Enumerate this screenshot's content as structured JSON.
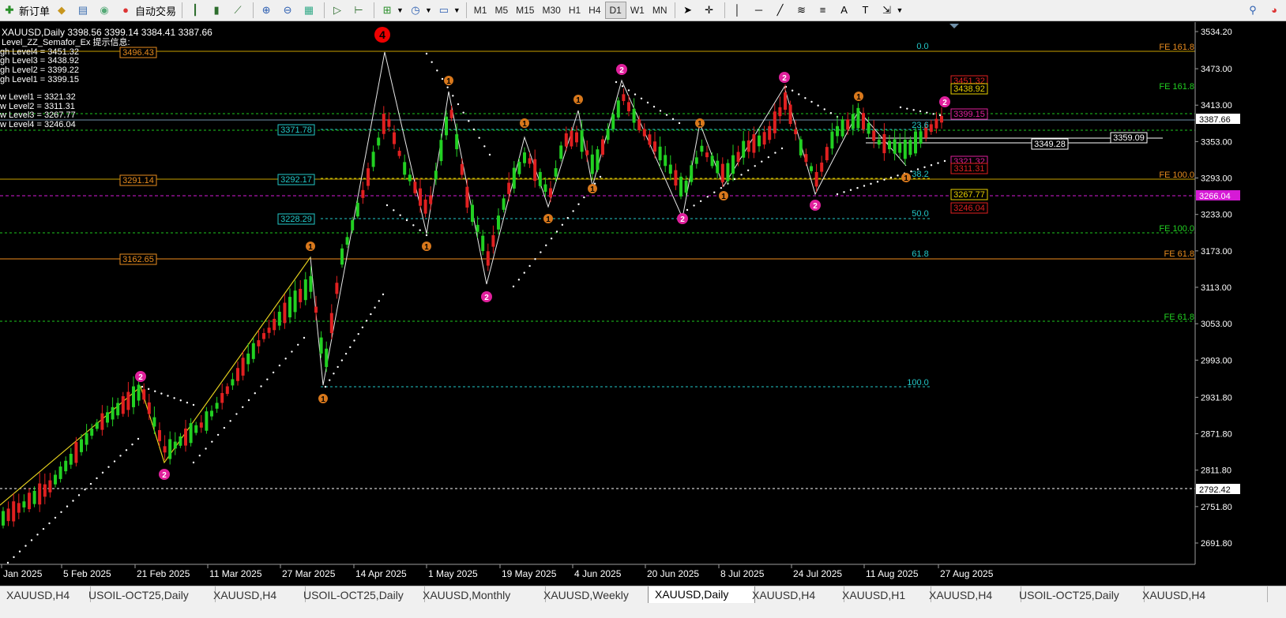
{
  "toolbar": {
    "new_order": "新订单",
    "auto_trading": "自动交易",
    "timeframes": [
      "M1",
      "M5",
      "M15",
      "M30",
      "H1",
      "H4",
      "D1",
      "W1",
      "MN"
    ],
    "active_timeframe": "D1"
  },
  "chart": {
    "symbol_line": "XAUUSD,Daily  3398.56 3399.14 3384.41 3387.66",
    "indicator_lines": [
      "Level_ZZ_Semafor_Ex 提示信息:",
      "gh Level4 = 3451.32",
      "gh Level3 = 3438.92",
      "gh Level2 = 3399.22",
      "gh Level1 = 3399.15",
      "w Level1 = 3321.32",
      "w Level2 = 3311.31",
      "w Level3 = 3267.77",
      "w Level4 = 3246.04"
    ],
    "price_axis": [
      "3534.20",
      "3473.00",
      "3413.00",
      "3353.00",
      "3293.00",
      "3233.00",
      "3173.00",
      "3113.00",
      "3053.00",
      "2993.00",
      "2931.80",
      "2871.80",
      "2811.80",
      "2751.80",
      "2691.80"
    ],
    "current_price": "3387.66",
    "magenta_price": "3266.04",
    "lower_price": "2792.42",
    "date_axis": [
      "Jan 2025",
      "5 Feb 2025",
      "21 Feb 2025",
      "11 Mar 2025",
      "27 Mar 2025",
      "14 Apr 2025",
      "1 May 2025",
      "19 May 2025",
      "4 Jun 2025",
      "20 Jun 2025",
      "8 Jul 2025",
      "24 Jul 2025",
      "11 Aug 2025",
      "27 Aug 2025"
    ],
    "left_labels": [
      "3496.43",
      "3291.14",
      "3162.65"
    ],
    "cyan_labels": [
      "3371.78",
      "3292.17",
      "3228.29"
    ],
    "fib_labels": [
      "0.0",
      "23.6",
      "38.2",
      "50.0",
      "61.8",
      "100.0"
    ],
    "fe_labels": [
      "FE 161.8",
      "FE 161.8",
      "FE 100.0",
      "FE 100.0",
      "FE 61.8",
      "FE 61.8"
    ],
    "level_labels": [
      "3451.32",
      "3438.92",
      "3399.15",
      "3321.32",
      "3311.31",
      "3267.77",
      "3246.04"
    ],
    "white_labels": [
      "3349.28",
      "3359.09"
    ],
    "big_marker": "4",
    "marker_1": "1",
    "marker_2": "2"
  },
  "tabs": [
    "XAUUSD,H4",
    "USOIL-OCT25,Daily",
    "XAUUSD,H4",
    "USOIL-OCT25,Daily",
    "XAUUSD,Monthly",
    "XAUUSD,Weekly",
    "XAUUSD,Daily",
    "XAUUSD,H4",
    "XAUUSD,H1",
    "XAUUSD,H4",
    "USOIL-OCT25,Daily",
    "XAUUSD,H4"
  ],
  "active_tab": "XAUUSD,Daily"
}
